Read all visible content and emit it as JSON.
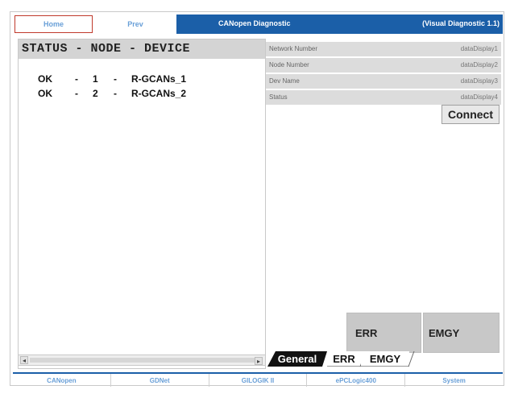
{
  "topbar": {
    "home_label": "Home",
    "prev_label": "Prev",
    "title": "CANopen Diagnostic",
    "subtitle": "(Visual Diagnostic 1.1)"
  },
  "node_panel": {
    "header": "STATUS - NODE - DEVICE",
    "rows": [
      {
        "status": "OK",
        "sep1": "-",
        "node": "1",
        "sep2": "-",
        "device": "R-GCANs_1"
      },
      {
        "status": "OK",
        "sep1": "-",
        "node": "2",
        "sep2": "-",
        "device": "R-GCANs_2"
      }
    ]
  },
  "info": {
    "rows": [
      {
        "label": "Network Number",
        "value": "dataDisplay1"
      },
      {
        "label": "Node Number",
        "value": "dataDisplay2"
      },
      {
        "label": "Dev Name",
        "value": "dataDisplay3"
      },
      {
        "label": "Status",
        "value": "dataDisplay4"
      }
    ],
    "connect_label": "Connect"
  },
  "buttons": {
    "err_label": "ERR",
    "emgy_label": "EMGY"
  },
  "tabs": [
    {
      "label": "General",
      "active": true
    },
    {
      "label": "ERR",
      "active": false
    },
    {
      "label": "EMGY",
      "active": false
    }
  ],
  "scroll": {
    "left_arrow": "◂",
    "right_arrow": "▸"
  },
  "bottom_nav": [
    "CANopen",
    "GDNet",
    "GILOGIK II",
    "ePCLogic400",
    "System"
  ],
  "colors": {
    "brand_blue": "#1b5fa8",
    "link_blue": "#6aa0d8",
    "home_border": "#c0392b",
    "panel_gray": "#d4d4d4"
  }
}
